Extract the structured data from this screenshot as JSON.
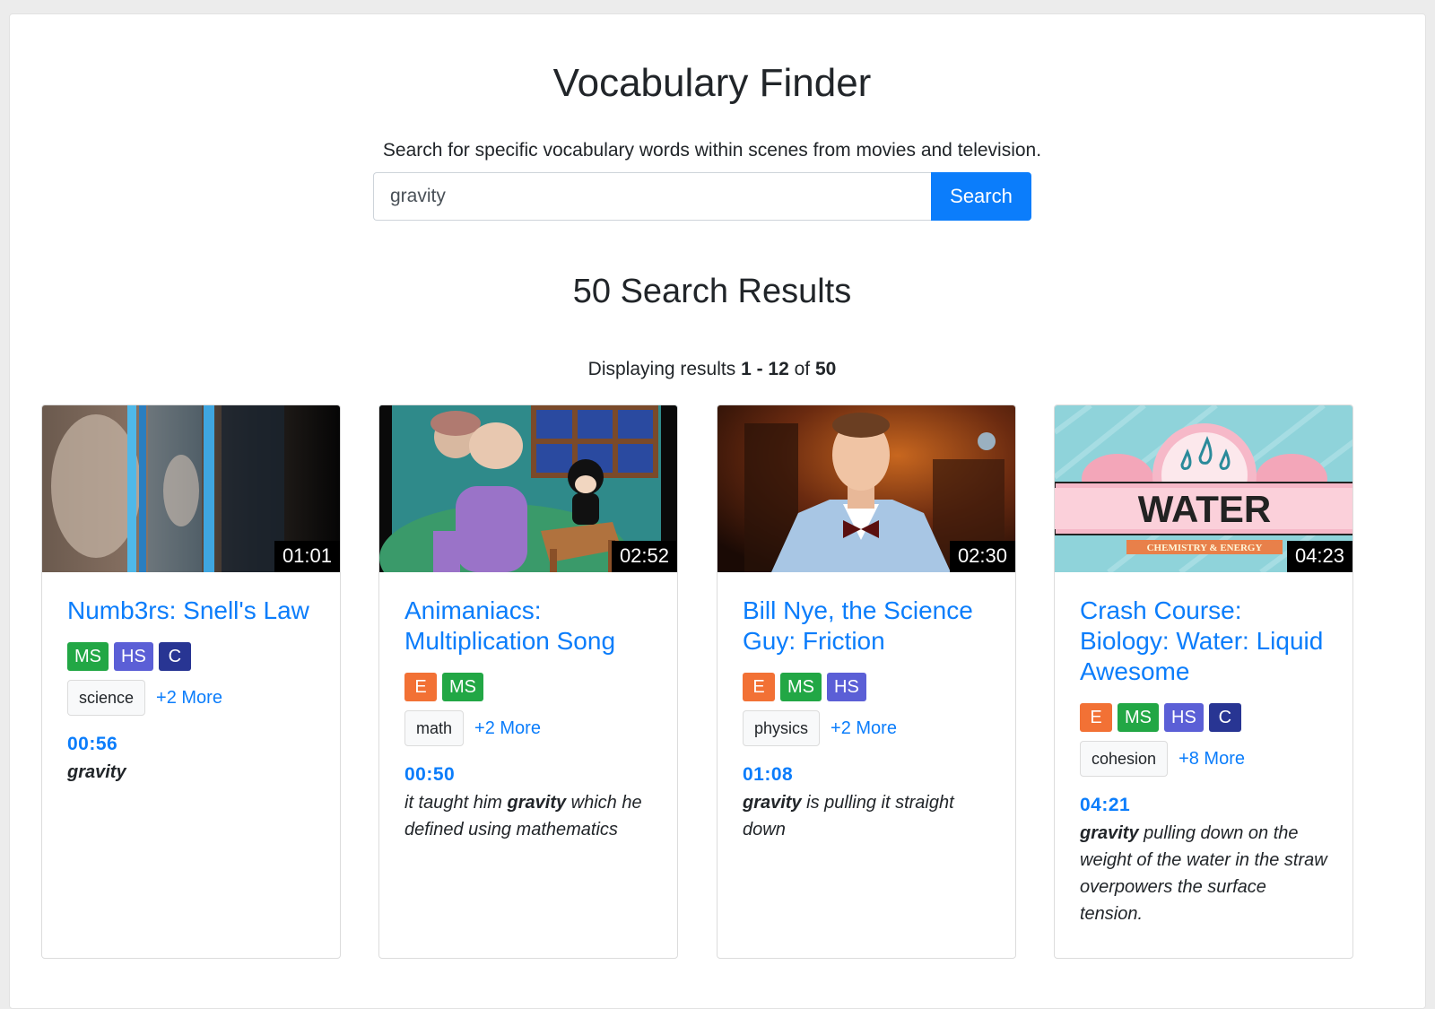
{
  "header": {
    "title": "Vocabulary Finder",
    "subtitle": "Search for specific vocabulary words within scenes from movies and television."
  },
  "search": {
    "value": "gravity",
    "button_label": "Search"
  },
  "results": {
    "heading": "50 Search Results",
    "meta_prefix": "Displaying results ",
    "range": "1 - 12",
    "meta_of": " of ",
    "total": "50"
  },
  "cards": [
    {
      "duration": "01:01",
      "title": "Numb3rs: Snell's Law",
      "levels": [
        "MS",
        "HS",
        "C"
      ],
      "tag": "science",
      "more": "+2 More",
      "timestamp": "00:56",
      "quote_before": "",
      "quote_keyword": "gravity",
      "quote_after": ""
    },
    {
      "duration": "02:52",
      "title": "Animaniacs: Multiplication Song",
      "levels": [
        "E",
        "MS"
      ],
      "tag": "math",
      "more": "+2 More",
      "timestamp": "00:50",
      "quote_before": "it taught him ",
      "quote_keyword": "gravity",
      "quote_after": " which he defined using mathematics"
    },
    {
      "duration": "02:30",
      "title": "Bill Nye, the Science Guy: Friction",
      "levels": [
        "E",
        "MS",
        "HS"
      ],
      "tag": "physics",
      "more": "+2 More",
      "timestamp": "01:08",
      "quote_before": "",
      "quote_keyword": "gravity",
      "quote_after": " is pulling it straight down"
    },
    {
      "duration": "04:23",
      "title": "Crash Course: Biology: Water: Liquid Awesome",
      "levels": [
        "E",
        "MS",
        "HS",
        "C"
      ],
      "tag": "cohesion",
      "more": "+8 More",
      "timestamp": "04:21",
      "quote_before": "",
      "quote_keyword": "gravity",
      "quote_after": " pulling down on the weight of the water in the straw overpowers the surface tension.",
      "thumb_text": "WATER",
      "thumb_subtext": "CHEMISTRY & ENERGY"
    }
  ],
  "colors": {
    "accent": "#0b7dfb",
    "level_E": "#f27135",
    "level_MS": "#22a745",
    "level_HS": "#5b5fd6",
    "level_C": "#283593"
  }
}
